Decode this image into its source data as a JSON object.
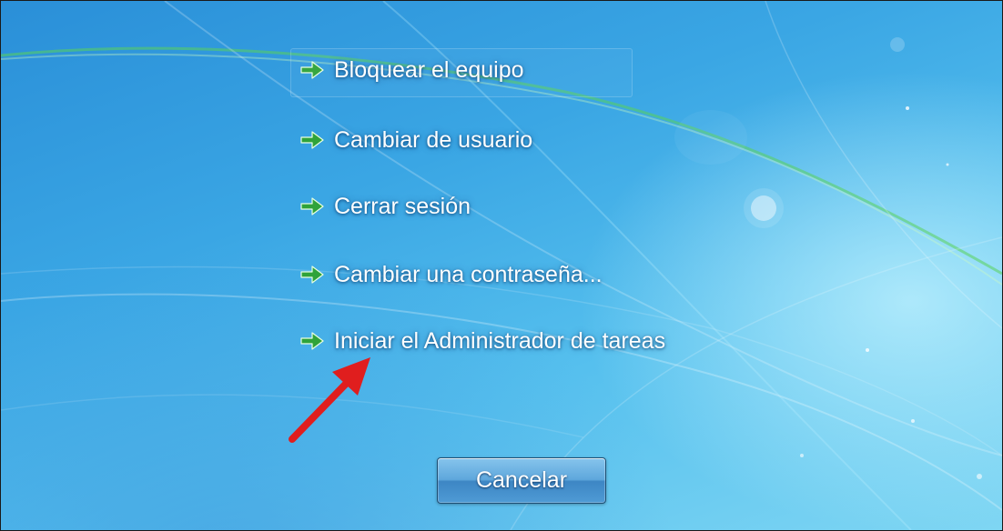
{
  "menu": {
    "items": [
      {
        "label": "Bloquear el equipo",
        "icon": "green-arrow-icon"
      },
      {
        "label": "Cambiar de usuario",
        "icon": "green-arrow-icon"
      },
      {
        "label": "Cerrar sesión",
        "icon": "green-arrow-icon"
      },
      {
        "label": "Cambiar una contraseña...",
        "icon": "green-arrow-icon"
      },
      {
        "label": "Iniciar el Administrador de tareas",
        "icon": "green-arrow-icon"
      }
    ]
  },
  "cancel_button": {
    "label": "Cancelar"
  },
  "colors": {
    "background": "#3aa6e4",
    "arrow_icon": "#2fa33a",
    "annotation_arrow": "#e01e1e",
    "text": "#ffffff"
  }
}
